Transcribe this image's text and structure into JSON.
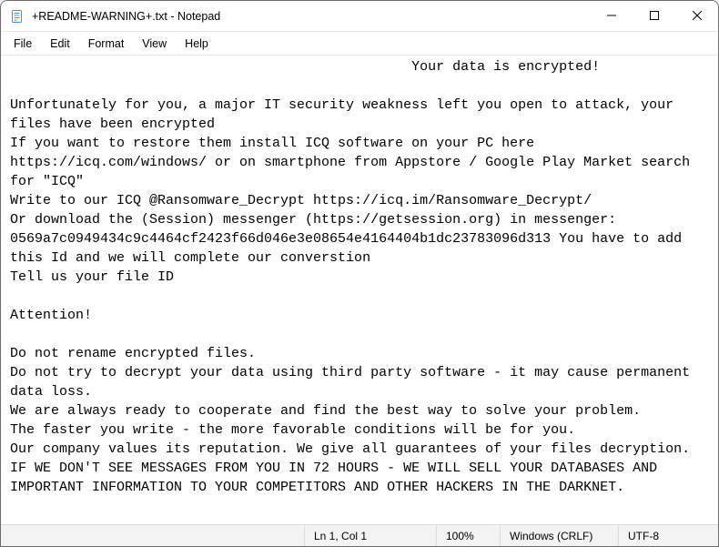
{
  "titlebar": {
    "title": "+README-WARNING+.txt - Notepad"
  },
  "menubar": {
    "file": "File",
    "edit": "Edit",
    "format": "Format",
    "view": "View",
    "help": "Help"
  },
  "document": {
    "text": "                                                 Your data is encrypted!\n\nUnfortunately for you, a major IT security weakness left you open to attack, your files have been encrypted\nIf you want to restore them install ICQ software on your PC here https://icq.com/windows/ or on smartphone from Appstore / Google Play Market search for \"ICQ\"\nWrite to our ICQ @Ransomware_Decrypt https://icq.im/Ransomware_Decrypt/\nOr download the (Session) messenger (https://getsession.org) in messenger: 0569a7c0949434c9c4464cf2423f66d046e3e08654e4164404b1dc23783096d313 You have to add this Id and we will complete our converstion\nTell us your file ID\n\nAttention!\n\nDo not rename encrypted files.\nDo not try to decrypt your data using third party software - it may cause permanent data loss.\nWe are always ready to cooperate and find the best way to solve your problem.\nThe faster you write - the more favorable conditions will be for you.\nOur company values its reputation. We give all guarantees of your files decryption.\nIF WE DON'T SEE MESSAGES FROM YOU IN 72 HOURS - WE WILL SELL YOUR DATABASES AND IMPORTANT INFORMATION TO YOUR COMPETITORS AND OTHER HACKERS IN THE DARKNET."
  },
  "statusbar": {
    "position": "Ln 1, Col 1",
    "zoom": "100%",
    "eol": "Windows (CRLF)",
    "encoding": "UTF-8"
  }
}
